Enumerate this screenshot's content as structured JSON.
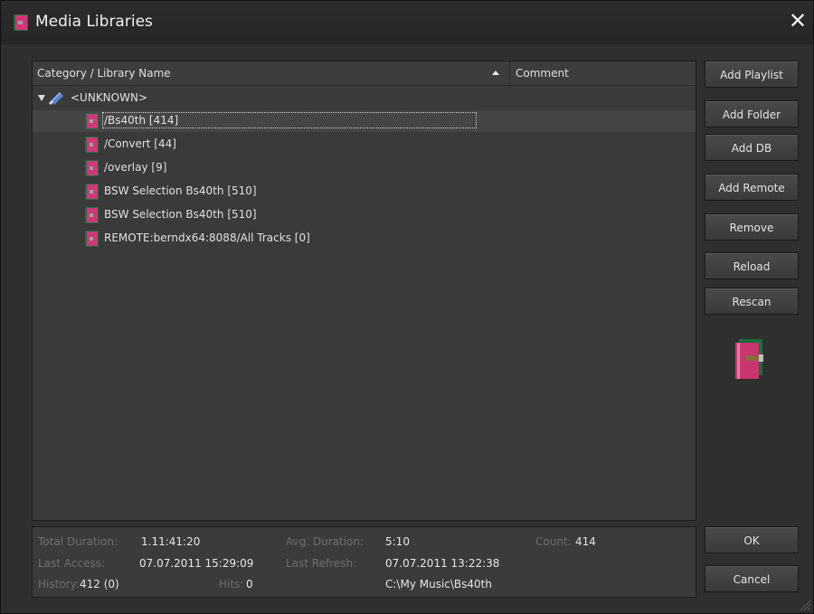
{
  "window": {
    "title": "Media Libraries",
    "close_glyph": "✕"
  },
  "tree": {
    "columns": {
      "name": "Category / Library Name",
      "comment": "Comment"
    },
    "root": {
      "label": "<UNKNOWN>",
      "icon": "database-icon"
    },
    "items": [
      {
        "label": "/Bs40th [414]",
        "selected": true
      },
      {
        "label": "/Convert [44]"
      },
      {
        "label": "/overlay [9]"
      },
      {
        "label": "BSW Selection Bs40th [510]"
      },
      {
        "label": "BSW Selection Bs40th [510]"
      },
      {
        "label": "REMOTE:berndx64:8088/All Tracks [0]"
      }
    ]
  },
  "buttons": {
    "add_playlist": "Add Playlist",
    "add_folder": "Add Folder",
    "add_db": "Add DB",
    "add_remote": "Add Remote",
    "remove": "Remove",
    "reload": "Reload",
    "rescan": "Rescan",
    "ok": "OK",
    "cancel": "Cancel"
  },
  "info": {
    "total_duration_label": "Total Duration:",
    "total_duration": "1.11:41:20",
    "avg_duration_label": "Avg. Duration:",
    "avg_duration": "5:10",
    "count_label": "Count:",
    "count": "414",
    "last_access_label": "Last Access:",
    "last_access": "07.07.2011 15:29:09",
    "last_refresh_label": "Last Refresh:",
    "last_refresh": "07.07.2011 13:22:38",
    "history_label": "History:",
    "history": "412 (0)",
    "hits_label": "Hits:",
    "hits": "0",
    "path": "C:\\My Music\\Bs40th"
  },
  "colors": {
    "accent": "#c0306a",
    "background": "#2f2f2f",
    "panel": "#3a3a3a",
    "label_muted": "#6e6e6e"
  }
}
